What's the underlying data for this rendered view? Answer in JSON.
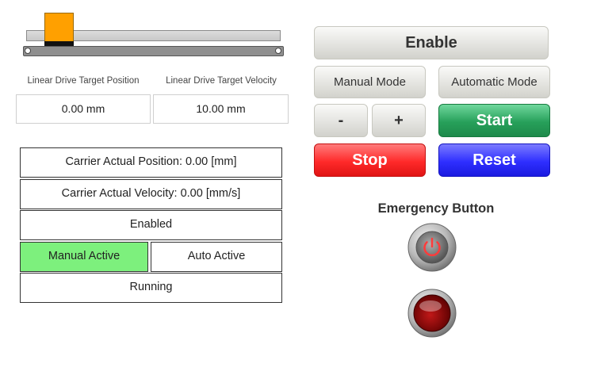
{
  "drive": {
    "target_position_label": "Linear Drive Target Position",
    "target_velocity_label": "Linear Drive Target Velocity",
    "target_position_value": "0.00 mm",
    "target_velocity_value": "10.00 mm"
  },
  "status": {
    "actual_position": "Carrier Actual Position: 0.00 [mm]",
    "actual_velocity": "Carrier Actual Velocity: 0.00 [mm/s]",
    "enabled": "Enabled",
    "manual_active": "Manual Active",
    "auto_active": "Auto Active",
    "running": "Running"
  },
  "controls": {
    "enable": "Enable",
    "manual_mode": "Manual Mode",
    "automatic_mode": "Automatic Mode",
    "minus": "-",
    "plus": "+",
    "start": "Start",
    "stop": "Stop",
    "reset": "Reset"
  },
  "emergency": {
    "title": "Emergency Button"
  },
  "colors": {
    "carrier": "#ffa000",
    "manual_active_bg": "#7df07d",
    "start": "#27a05a",
    "stop": "#ff2a2a",
    "reset": "#2f2fff"
  }
}
